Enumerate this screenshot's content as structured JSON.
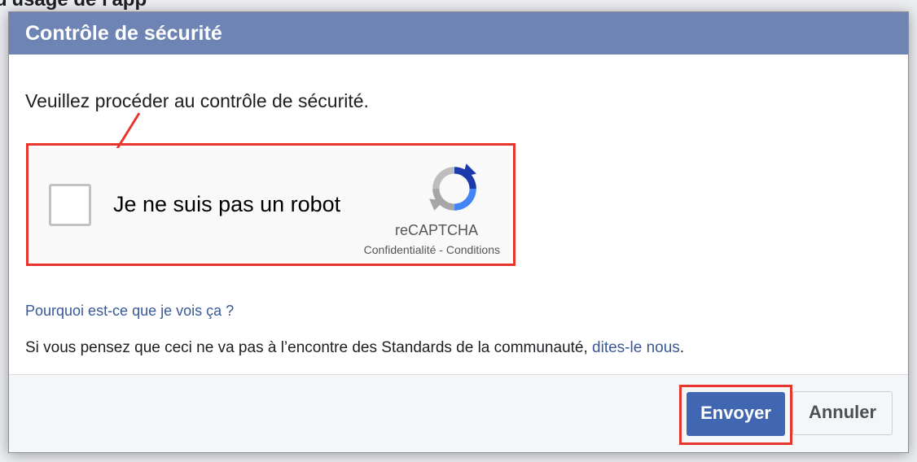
{
  "background": {
    "title_fragment": "d'usage de l'app"
  },
  "dialog": {
    "title": "Contrôle de sécurité",
    "intro": "Veuillez procéder au contrôle de sécurité.",
    "captcha": {
      "label": "Je ne suis pas un robot",
      "brand": "reCAPTCHA",
      "privacy": "Confidentialité",
      "separator": " - ",
      "terms": "Conditions"
    },
    "why_link": "Pourquoi est-ce que je vois ça ?",
    "community_prefix": "Si vous pensez que ceci ne va pas à l’encontre des Standards de la communauté, ",
    "community_link": "dites-le nous",
    "community_suffix": "."
  },
  "buttons": {
    "submit": "Envoyer",
    "cancel": "Annuler"
  },
  "colors": {
    "header_bg": "#6d84b4",
    "primary_button": "#4267b2",
    "link": "#385898",
    "highlight": "#e8352d"
  }
}
